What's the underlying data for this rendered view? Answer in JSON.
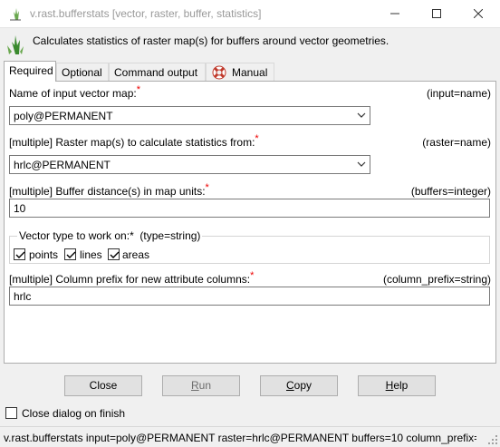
{
  "window": {
    "title": "v.rast.bufferstats [vector, raster, buffer, statistics]"
  },
  "header": {
    "description": "Calculates statistics of raster map(s) for buffers around vector geometries."
  },
  "tabs": [
    {
      "label": "Required"
    },
    {
      "label": "Optional"
    },
    {
      "label": "Command output"
    },
    {
      "label": "Manual"
    }
  ],
  "fields": {
    "input": {
      "label": "Name of input vector map:",
      "param": "(input=name)",
      "value": "poly@PERMANENT"
    },
    "raster": {
      "label": "[multiple] Raster map(s) to calculate statistics from:",
      "param": "(raster=name)",
      "value": "hrlc@PERMANENT"
    },
    "buffers": {
      "label": "[multiple] Buffer distance(s) in map units:",
      "param": "(buffers=integer)",
      "value": "10"
    },
    "type": {
      "legend": "Vector type to work on:*",
      "param": "(type=string)",
      "options": [
        {
          "label": "points",
          "checked": true
        },
        {
          "label": "lines",
          "checked": true
        },
        {
          "label": "areas",
          "checked": true
        }
      ]
    },
    "column_prefix": {
      "label": "[multiple] Column prefix for new attribute columns:",
      "param": "(column_prefix=string)",
      "value": "hrlc"
    }
  },
  "required_marker": "*",
  "buttons": {
    "close": "Close",
    "run_pre": "",
    "run_u": "R",
    "run_post": "un",
    "copy_pre": "",
    "copy_u": "C",
    "copy_post": "opy",
    "help_pre": "",
    "help_u": "H",
    "help_post": "elp"
  },
  "close_on_finish": {
    "label": "Close dialog on finish",
    "checked": false
  },
  "status": {
    "command": "v.rast.bufferstats input=poly@PERMANENT raster=hrlc@PERMANENT buffers=10 column_prefix=..."
  },
  "colors": {
    "required": "#e00000",
    "accent": "#3a8a2e"
  },
  "icons": {
    "app": "grass-icon",
    "manual": "lifebuoy-icon"
  }
}
